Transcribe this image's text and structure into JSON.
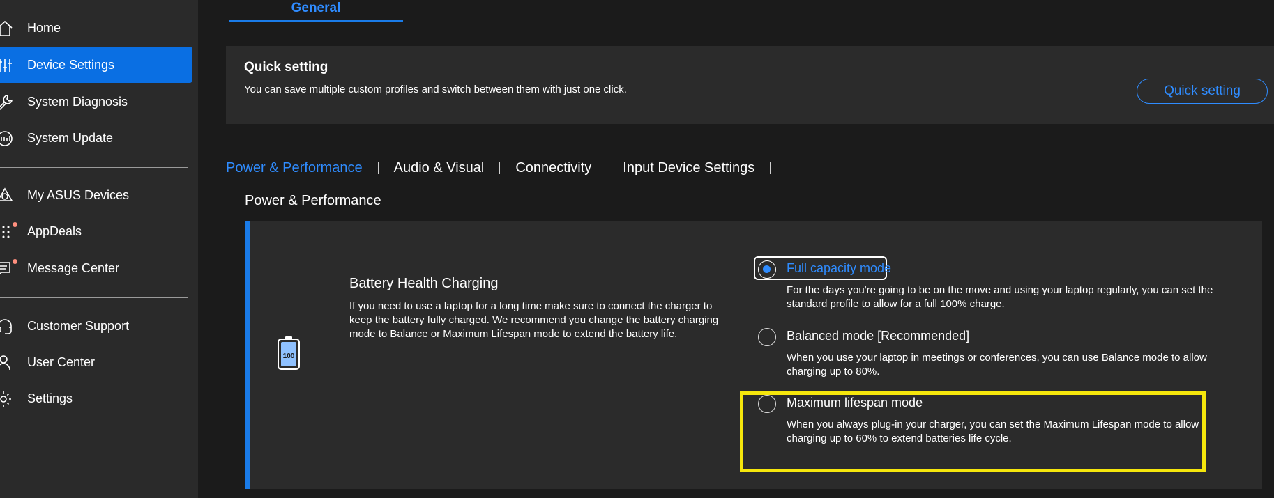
{
  "sidebar": {
    "items": [
      {
        "label": "Home",
        "icon": "home-icon"
      },
      {
        "label": "Device Settings",
        "icon": "sliders-icon",
        "active": true
      },
      {
        "label": "System Diagnosis",
        "icon": "wrench-icon"
      },
      {
        "label": "System Update",
        "icon": "update-icon"
      },
      {
        "label": "My ASUS Devices",
        "icon": "devices-icon"
      },
      {
        "label": "AppDeals",
        "icon": "apps-grid-icon",
        "badge_dot": true
      },
      {
        "label": "Message Center",
        "icon": "message-icon",
        "badge_dot": true
      },
      {
        "label": "Customer Support",
        "icon": "headset-icon"
      },
      {
        "label": "User Center",
        "icon": "user-icon"
      },
      {
        "label": "Settings",
        "icon": "gear-icon"
      }
    ]
  },
  "tabs": {
    "general": "General"
  },
  "quick_setting": {
    "title": "Quick setting",
    "description": "You can save multiple custom profiles and switch between them with just one click.",
    "button_label": "Quick setting"
  },
  "subtabs": [
    {
      "label": "Power & Performance",
      "active": true
    },
    {
      "label": "Audio & Visual"
    },
    {
      "label": "Connectivity"
    },
    {
      "label": "Input Device Settings"
    }
  ],
  "section_title": "Power & Performance",
  "battery_health": {
    "icon": "battery-icon",
    "battery_level": "100",
    "title": "Battery Health Charging",
    "description": "If you need to use a laptop for a long time make sure to connect the charger to keep the battery fully charged. We recommend you change the battery charging mode to Balance or Maximum Lifespan mode to extend the battery life.",
    "options": [
      {
        "label": "Full capacity mode",
        "selected": true,
        "description": "For the days you're going to be on the move and using your laptop regularly, you can set the standard profile to allow for a full 100% charge."
      },
      {
        "label": "Balanced mode [Recommended]",
        "selected": false,
        "description": "When you use your laptop in meetings or conferences, you can use Balance mode to allow charging up to 80%."
      },
      {
        "label": "Maximum lifespan mode",
        "selected": false,
        "description": "When you always plug-in your charger, you can set the Maximum Lifespan mode to allow charging up to 60% to extend batteries life cycle."
      }
    ]
  },
  "colors": {
    "accent": "#2f8cff",
    "sidebar_active": "#0a6fe3",
    "highlight": "#f5e60c",
    "background": "#1b1b1b",
    "sidebar_bg": "#2a2a2a",
    "card_bg": "#2b2b2b"
  }
}
